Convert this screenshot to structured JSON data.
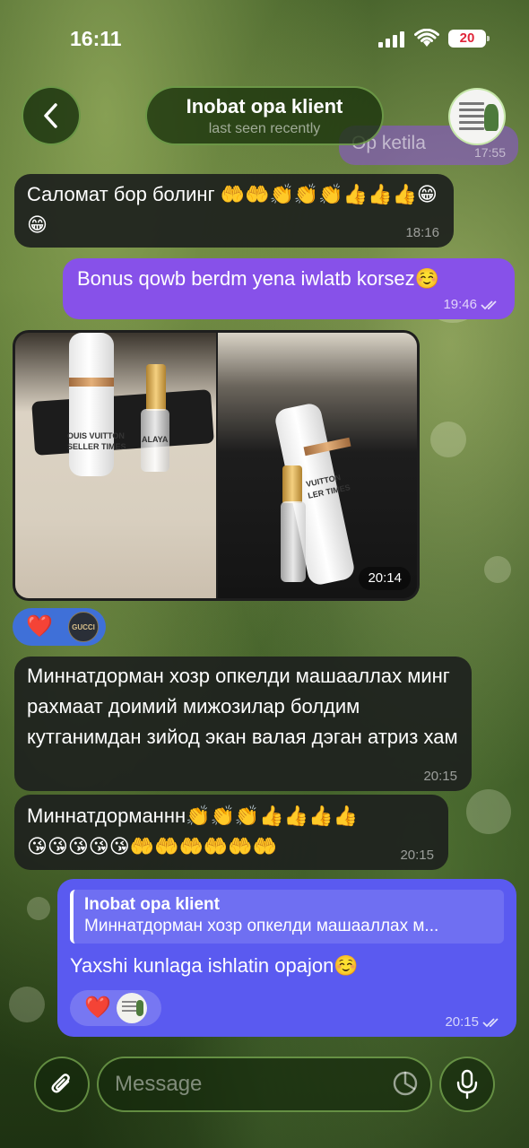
{
  "status_bar": {
    "time": "16:11",
    "battery_level": "20"
  },
  "header": {
    "title": "Inobat opa klient",
    "subtitle": "last seen recently"
  },
  "partial_message": {
    "text": "Op ketila",
    "time": "17:55"
  },
  "messages": [
    {
      "direction": "incoming",
      "text": "Саломат бор болинг 🤲🤲👏👏👏👍👍👍😁😁",
      "time": "18:16"
    },
    {
      "direction": "outgoing",
      "text": "Bonus qowb berdm yena iwlatb korsez☺️",
      "time": "19:46",
      "read": true
    },
    {
      "direction": "incoming",
      "type": "album",
      "time": "20:14",
      "photos": [
        {
          "label_lines": [
            "OUIS VUITTON",
            "SELLER TIMES"
          ],
          "small_label": "ALAYA"
        },
        {
          "label_lines": [
            "VUITTON",
            "LER TIMES"
          ]
        }
      ],
      "reactions": [
        "❤️"
      ],
      "reactor_badge": "GUCCI"
    },
    {
      "direction": "incoming",
      "text": "Миннатдорман хозр опкелди машааллах минг рахмаат доимий мижозилар болдим кутганимдан зийод экан валая дэган атриз хам",
      "time": "20:15"
    },
    {
      "direction": "incoming",
      "text": "Миннатдорманнн👏👏👏👍👍👍👍😘😘😘😘😘🤲🤲🤲🤲🤲🤲",
      "time": "20:15"
    },
    {
      "direction": "outgoing",
      "text": "Yaxshi kunlaga ishlatin opajon☺️",
      "time": "20:15",
      "read": true,
      "reply": {
        "author": "Inobat opa klient",
        "text": "Миннатдорман хозр опкелди машааллах м..."
      },
      "reactions": [
        "❤️"
      ]
    }
  ],
  "input": {
    "placeholder": "Message"
  },
  "icons": {
    "back": "chevron-left-icon",
    "attach": "paperclip-icon",
    "sticker": "sticker-icon",
    "mic": "microphone-icon"
  },
  "colors": {
    "outgoing_bubble": "#8751e9",
    "reply_bubble": "#5a5af0",
    "incoming_bubble": "#1e211e",
    "reaction_pill": "#3f70d8",
    "heart": "#e8243a"
  }
}
